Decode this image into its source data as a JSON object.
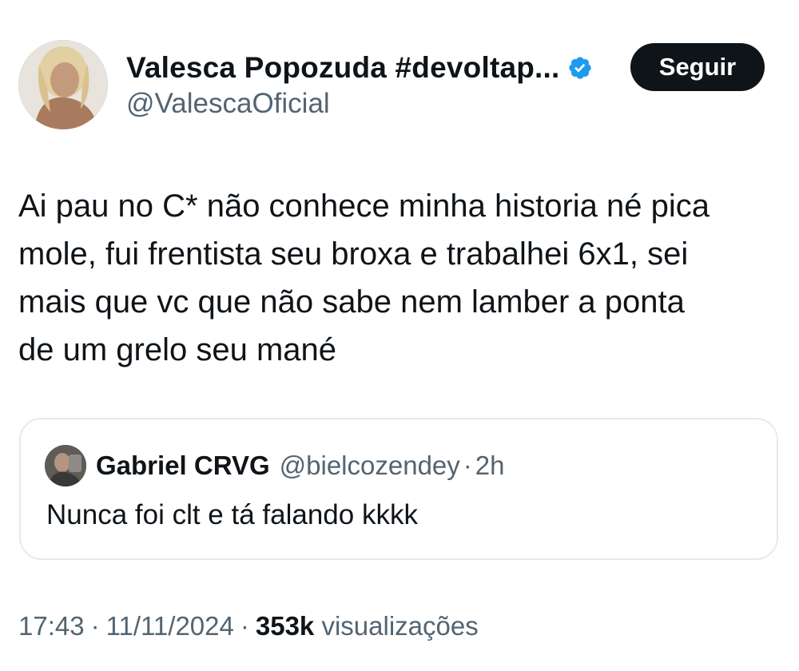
{
  "author": {
    "display_name": "Valesca Popozuda #devoltap...",
    "handle": "@ValescaOficial",
    "verified_icon": "verified-badge-icon",
    "verified_color": "#1d9bf0"
  },
  "follow_button": {
    "label": "Seguir"
  },
  "tweet": {
    "text": "Ai pau no C* não conhece minha historia né pica\nmole, fui frentista seu broxa e trabalhei 6x1, sei\nmais que vc que não sabe nem lamber a ponta\nde um grelo seu mané"
  },
  "quote": {
    "display_name": "Gabriel CRVG",
    "handle": "@bielcozendey",
    "separator": "·",
    "time": "2h",
    "text": "Nunca foi clt e tá falando kkkk"
  },
  "meta": {
    "time": "17:43",
    "separator": "·",
    "date": "11/11/2024",
    "views_count": "353k",
    "views_label": "visualizações"
  },
  "colors": {
    "text_primary": "#0f1419",
    "text_secondary": "#536471",
    "border": "#e6eaed",
    "button_bg": "#0f1419",
    "button_text": "#ffffff"
  }
}
